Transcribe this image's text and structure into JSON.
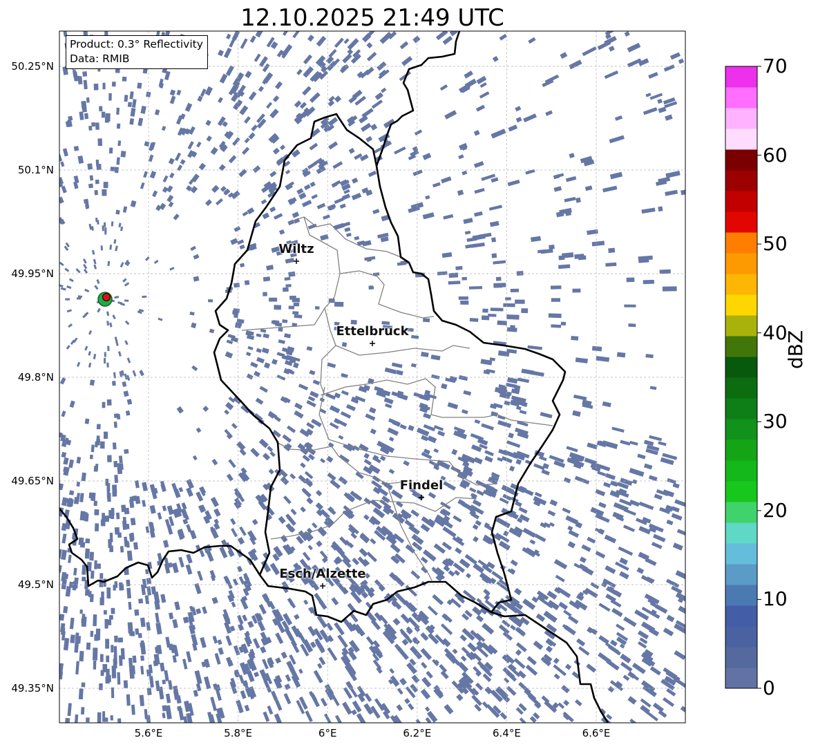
{
  "title": "12.10.2025 21:49 UTC",
  "info": {
    "product": "Product: 0.3° Reflectivity",
    "data": "Data: RMIB"
  },
  "extent": {
    "lon_min": 5.4,
    "lon_max": 6.8,
    "lat_min": 49.3,
    "lat_max": 50.3
  },
  "lat_ticks": [
    {
      "value": 50.25,
      "label": "50.25°N"
    },
    {
      "value": 50.1,
      "label": "50.1°N"
    },
    {
      "value": 49.95,
      "label": "49.95°N"
    },
    {
      "value": 49.8,
      "label": "49.8°N"
    },
    {
      "value": 49.65,
      "label": "49.65°N"
    },
    {
      "value": 49.5,
      "label": "49.5°N"
    },
    {
      "value": 49.35,
      "label": "49.35°N"
    }
  ],
  "lon_ticks": [
    {
      "value": 5.6,
      "label": "5.6°E"
    },
    {
      "value": 5.8,
      "label": "5.8°E"
    },
    {
      "value": 6.0,
      "label": "6°E"
    },
    {
      "value": 6.2,
      "label": "6.2°E"
    },
    {
      "value": 6.4,
      "label": "6.4°E"
    },
    {
      "value": 6.6,
      "label": "6.6°E"
    }
  ],
  "cities": [
    {
      "name": "Wiltz",
      "lon": 5.93,
      "lat": 49.966
    },
    {
      "name": "Ettelbruck",
      "lon": 6.1,
      "lat": 49.847
    },
    {
      "name": "Findel",
      "lon": 6.21,
      "lat": 49.627
    },
    {
      "name": "Esch/Alzette",
      "lon": 5.99,
      "lat": 49.499
    }
  ],
  "radar_site": {
    "lon": 5.505,
    "lat": 49.914
  },
  "colorbar": {
    "label": "dBZ",
    "min": 0,
    "max": 70,
    "ticks": [
      {
        "value": 70,
        "label": "70"
      },
      {
        "value": 60,
        "label": "60"
      },
      {
        "value": 50,
        "label": "50"
      },
      {
        "value": 40,
        "label": "40"
      },
      {
        "value": 30,
        "label": "30"
      },
      {
        "value": 20,
        "label": "20"
      },
      {
        "value": 10,
        "label": "10"
      },
      {
        "value": 0,
        "label": "0"
      }
    ],
    "colors": [
      "#6272a4",
      "#55699e",
      "#4a62a2",
      "#435ea6",
      "#4b7ab3",
      "#5a9cc7",
      "#64bedb",
      "#5fd8c6",
      "#40d36b",
      "#18c71b",
      "#14b81a",
      "#13a515",
      "#11921b",
      "#0e7e16",
      "#0b6d10",
      "#075a0c",
      "#42760a",
      "#a9b20a",
      "#ffd700",
      "#fdb603",
      "#fe9a01",
      "#fe7f00",
      "#e20600",
      "#c20000",
      "#9c0000",
      "#7a0000",
      "#ffdcff",
      "#ffb2ff",
      "#ff6eff",
      "#ec30ec"
    ]
  },
  "echo_color": "#6577a5",
  "colors": {
    "border": "#000000",
    "admin": "#808080",
    "grid": "#b0b0b0",
    "radar_dot": "#e01010",
    "radar_ring": "#22aa22"
  }
}
